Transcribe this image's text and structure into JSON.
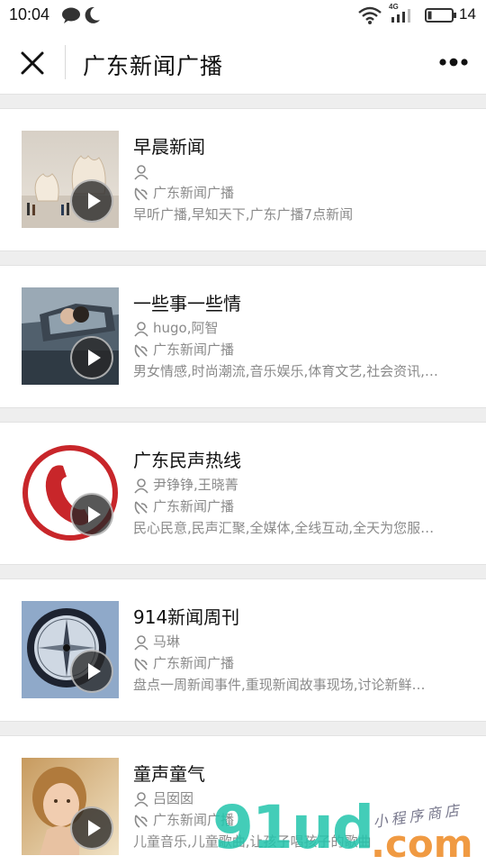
{
  "status_bar": {
    "time": "10:04",
    "battery_level": "14",
    "network_label": "4G",
    "icons": [
      "chat-bubble-icon",
      "moon-icon",
      "wifi-icon",
      "signal-icon",
      "battery-icon"
    ]
  },
  "navbar": {
    "title": "广东新闻广播",
    "close_icon": "close-icon",
    "more_icon": "more-dots-icon"
  },
  "programs": [
    {
      "title": "早晨新闻",
      "hosts": "",
      "station": "广东新闻广播",
      "description": "早听广播,早知天下,广东广播7点新闻",
      "thumb": "eggshell"
    },
    {
      "title": "一些事一些情",
      "hosts": "hugo,阿智",
      "station": "广东新闻广播",
      "description": "男女情感,时尚潮流,音乐娱乐,体育文艺,社会资讯,…",
      "thumb": "couple-car"
    },
    {
      "title": "广东民声热线",
      "hosts": "尹铮铮,王晓菁",
      "station": "广东新闻广播",
      "description": "民心民意,民声汇聚,全媒体,全线互动,全天为您服…",
      "thumb": "phone-logo"
    },
    {
      "title": "914新闻周刊",
      "hosts": "马琳",
      "station": "广东新闻广播",
      "description": "盘点一周新闻事件,重现新闻故事现场,讨论新鲜…",
      "thumb": "compass"
    },
    {
      "title": "童声童气",
      "hosts": "吕囡囡",
      "station": "广东新闻广播",
      "description": "儿童音乐,儿童歌曲,让孩子唱孩子的歌曲",
      "thumb": "child"
    }
  ],
  "watermark": {
    "brand": "91ud",
    "suffix": ".com",
    "tagline": "小程序商店"
  },
  "colors": {
    "separator": "#eeeeee",
    "secondary_text": "#8a8a8a",
    "phone_red": "#c8262a",
    "watermark_green": "#22c4ac",
    "watermark_orange": "#ee8c28"
  }
}
